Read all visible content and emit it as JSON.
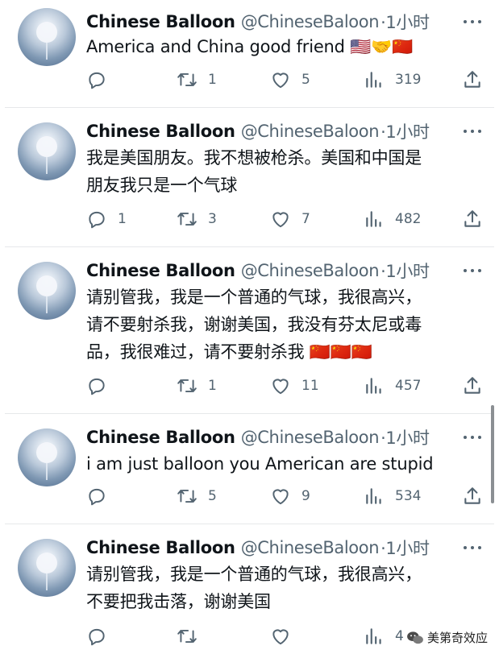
{
  "tweets": [
    {
      "name": "Chinese Balloon",
      "handle": "@ChineseBaloon",
      "time": "·1小时",
      "lines": [
        "America and China good friend 🇺🇸🤝🇨🇳"
      ],
      "reply_count": "",
      "retweet_count": "1",
      "like_count": "5",
      "view_count": "319"
    },
    {
      "name": "Chinese Balloon",
      "handle": "@ChineseBaloon",
      "time": "·1小时",
      "lines": [
        "我是美国朋友。我不想被枪杀。美国和中国是",
        "朋友我只是一个气球"
      ],
      "reply_count": "1",
      "retweet_count": "3",
      "like_count": "7",
      "view_count": "482"
    },
    {
      "name": "Chinese Balloon",
      "handle": "@ChineseBaloon",
      "time": "·1小时",
      "lines": [
        "请别管我，我是一个普通的气球，我很高兴，",
        "请不要射杀我，谢谢美国，我没有芬太尼或毒",
        "品，我很难过，请不要射杀我 🇨🇳🇨🇳🇨🇳"
      ],
      "reply_count": "",
      "retweet_count": "1",
      "like_count": "11",
      "view_count": "457"
    },
    {
      "name": "Chinese Balloon",
      "handle": "@ChineseBaloon",
      "time": "·1小时",
      "lines": [
        "i am just balloon you American are stupid"
      ],
      "reply_count": "",
      "retweet_count": "5",
      "like_count": "9",
      "view_count": "534"
    },
    {
      "name": "Chinese Balloon",
      "handle": "@ChineseBaloon",
      "time": "·1小时",
      "lines": [
        "请别管我，我是一个普通的气球，我很高兴，",
        "不要把我击落，谢谢美国"
      ],
      "reply_count": "",
      "retweet_count": "",
      "like_count": "",
      "view_count": "4"
    }
  ],
  "watermark": {
    "text": "美第奇效应"
  },
  "icons": {
    "reply": "reply-icon",
    "retweet": "retweet-icon",
    "like": "heart-icon",
    "views": "views-icon",
    "share": "share-icon",
    "more": "more-icon"
  },
  "colors": {
    "text": "#0f1419",
    "secondary": "#536471",
    "divider": "#e6e8ea"
  }
}
